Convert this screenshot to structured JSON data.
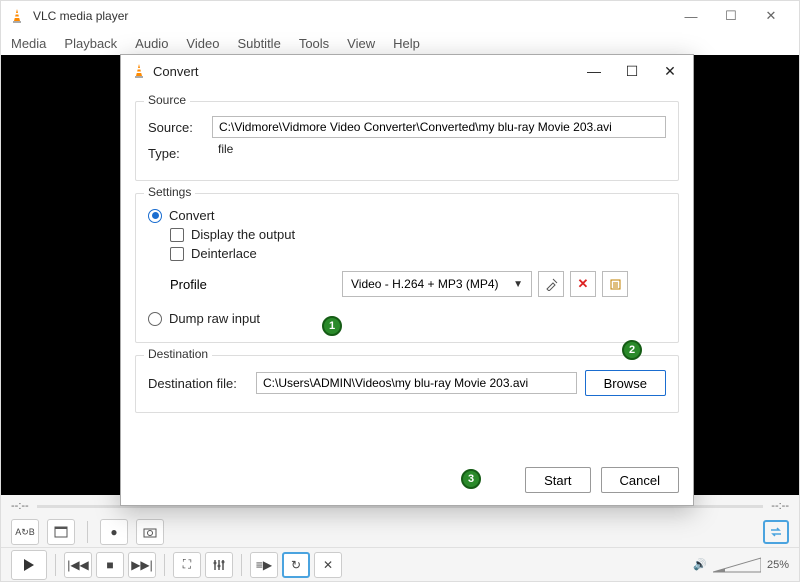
{
  "main": {
    "title": "VLC media player",
    "menu": [
      "Media",
      "Playback",
      "Audio",
      "Video",
      "Subtitle",
      "Tools",
      "View",
      "Help"
    ],
    "time_left": "--:--",
    "time_right": "--:--",
    "volume_pct": "25%"
  },
  "dialog": {
    "title": "Convert",
    "source": {
      "group": "Source",
      "source_label": "Source:",
      "source_value": "C:\\Vidmore\\Vidmore Video Converter\\Converted\\my blu-ray Movie 203.avi",
      "type_label": "Type:",
      "type_value": "file"
    },
    "settings": {
      "group": "Settings",
      "convert_label": "Convert",
      "display_label": "Display the output",
      "deinterlace_label": "Deinterlace",
      "profile_label": "Profile",
      "profile_value": "Video - H.264 + MP3 (MP4)",
      "dump_label": "Dump raw input"
    },
    "destination": {
      "group": "Destination",
      "dest_label": "Destination file:",
      "dest_value": "C:\\Users\\ADMIN\\Videos\\my blu-ray Movie 203.avi",
      "browse": "Browse"
    },
    "buttons": {
      "start": "Start",
      "cancel": "Cancel"
    }
  },
  "annotations": {
    "b1": "1",
    "b2": "2",
    "b3": "3"
  }
}
